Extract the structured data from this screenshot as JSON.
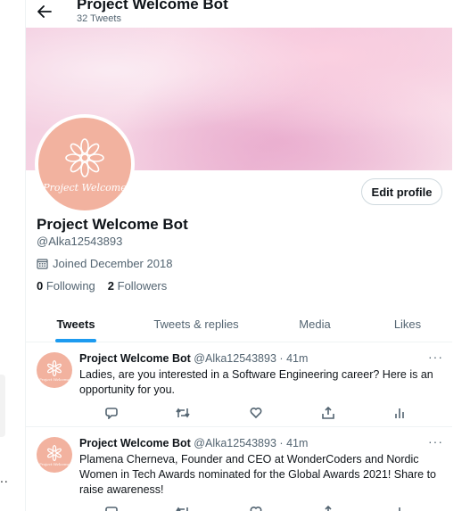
{
  "header": {
    "title": "Project Welcome Bot",
    "tweet_count": "32 Tweets",
    "back_icon": "arrow-left-icon"
  },
  "profile": {
    "name": "Project Welcome Bot",
    "handle": "@Alka12543893",
    "joined": "Joined December 2018",
    "following_count": "0",
    "following_label": "Following",
    "followers_count": "2",
    "followers_label": "Followers",
    "edit_button": "Edit profile",
    "avatar_text": "Project Welcome"
  },
  "tabs": [
    {
      "label": "Tweets",
      "active": true
    },
    {
      "label": "Tweets & replies",
      "active": false
    },
    {
      "label": "Media",
      "active": false
    },
    {
      "label": "Likes",
      "active": false
    }
  ],
  "tweets": [
    {
      "name": "Project Welcome Bot",
      "handle": "@Alka12543893",
      "separator": "·",
      "time": "41m",
      "text": "Ladies, are you interested in a Software Engineering career? Here is an opportunity for you."
    },
    {
      "name": "Project Welcome Bot",
      "handle": "@Alka12543893",
      "separator": "·",
      "time": "41m",
      "text": "Plamena Cherneva, Founder and CEO at WonderCoders and Nordic Women in Tech Awards nominated for the Global Awards 2021! Share to raise awareness!"
    }
  ],
  "colors": {
    "accent": "#1d9bf0",
    "avatar_bg": "#f2b29f",
    "secondary_text": "#536471"
  },
  "gutter": {
    "ellipsis": ".."
  }
}
